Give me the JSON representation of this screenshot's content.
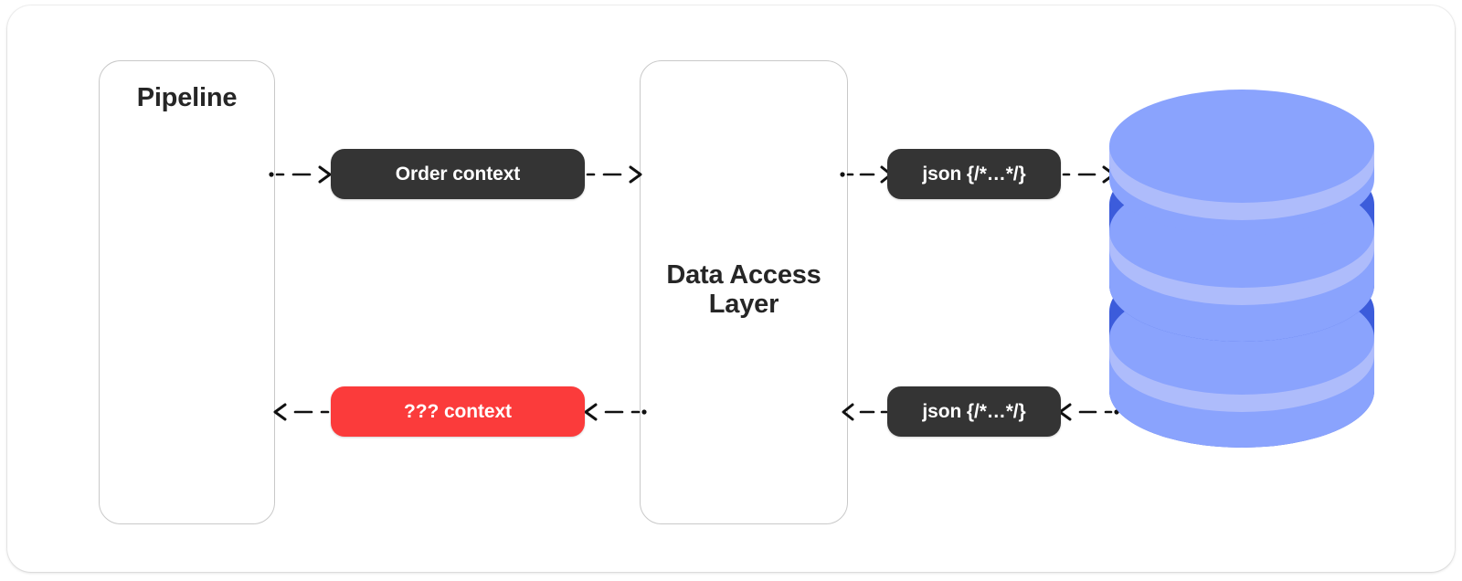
{
  "diagram": {
    "type": "flow-diagram",
    "title": "Pipeline to Data Access Layer to Database flow",
    "background": "#ffffff",
    "frame_radius_px": 26
  },
  "colors": {
    "dark_pill": "#343434",
    "red_pill": "#FB3B3B",
    "database_body": "#8AA3FD",
    "database_highlight": "#AEBCFB",
    "database_shadow": "#3C5CDB",
    "lane_border": "#C9C9C9",
    "text_dark": "#262626",
    "text_light": "#FFFFFF",
    "connector": "#111111"
  },
  "lanes": [
    {
      "id": "pipeline",
      "label": "Pipeline",
      "title_align": "center-top"
    },
    {
      "id": "data-access-layer",
      "label": "Data Access\nLayer",
      "label_line1": "Data Access",
      "label_line2": "Layer",
      "title_align": "center-middle"
    }
  ],
  "nodes": [
    {
      "id": "order-context",
      "label": "Order context",
      "style": "dark",
      "row": "top"
    },
    {
      "id": "unknown-context",
      "label": "??? context",
      "style": "red",
      "row": "bottom"
    },
    {
      "id": "json-request",
      "label": "json {/*…*/}",
      "style": "dark",
      "row": "top"
    },
    {
      "id": "json-response",
      "label": "json {/*…*/}",
      "style": "dark",
      "row": "bottom"
    }
  ],
  "database": {
    "id": "database",
    "icon": "database-cylinder-icon",
    "disks": 3,
    "label": ""
  },
  "connectors": [
    {
      "id": "pipeline-to-order-context",
      "direction": "right",
      "style": "dashed",
      "row": "top"
    },
    {
      "id": "order-context-to-dal",
      "direction": "right",
      "style": "dashed",
      "row": "top"
    },
    {
      "id": "dal-to-json-request",
      "direction": "right",
      "style": "dashed",
      "row": "top"
    },
    {
      "id": "json-request-to-database",
      "direction": "right",
      "style": "dashed",
      "row": "top"
    },
    {
      "id": "unknown-context-to-pipeline",
      "direction": "left",
      "style": "dashed",
      "row": "bottom"
    },
    {
      "id": "dal-to-unknown-context",
      "direction": "left",
      "style": "dashed",
      "row": "bottom"
    },
    {
      "id": "json-response-to-dal",
      "direction": "left",
      "style": "dashed",
      "row": "bottom"
    },
    {
      "id": "database-to-json-response",
      "direction": "left",
      "style": "dashed",
      "row": "bottom"
    }
  ]
}
